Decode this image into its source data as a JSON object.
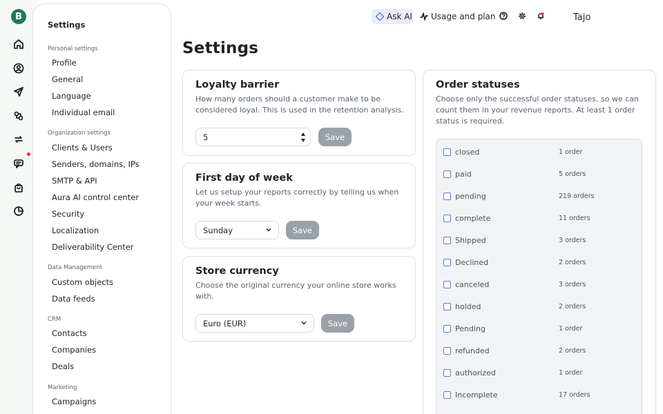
{
  "brand": {
    "logo_letter": "B"
  },
  "topbar": {
    "ask_ai": "Ask AI",
    "usage": "Usage and plan",
    "user_name": "Tajo"
  },
  "sidebar": {
    "title": "Settings",
    "sections": [
      {
        "label": "Personal settings",
        "items": [
          "Profile",
          "General",
          "Language",
          "Individual email"
        ]
      },
      {
        "label": "Organization settings",
        "items": [
          "Clients & Users",
          "Senders, domains, IPs",
          "SMTP & API",
          "Aura AI control center",
          "Security",
          "Localization",
          "Deliverability Center"
        ]
      },
      {
        "label": "Data Management",
        "items": [
          "Custom objects",
          "Data feeds"
        ]
      },
      {
        "label": "CRM",
        "items": [
          "Contacts",
          "Companies",
          "Deals"
        ]
      },
      {
        "label": "Marketing",
        "items": [
          "Campaigns"
        ]
      }
    ]
  },
  "page": {
    "title": "Settings"
  },
  "loyalty": {
    "title": "Loyalty barrier",
    "desc1": "How many orders should a customer make to be",
    "desc2": "considered loyal. This is used in the retention analysis.",
    "value": "5",
    "save": "Save"
  },
  "week": {
    "title": "First day of week",
    "desc1": "Let us setup your reports correctly by telling us when",
    "desc2": "your week starts.",
    "value": "Sunday",
    "save": "Save"
  },
  "currency": {
    "title": "Store currency",
    "desc1": "Choose the original currency your online store works",
    "desc2": "with.",
    "value": "Euro (EUR)",
    "save": "Save"
  },
  "statuses": {
    "title": "Order statuses",
    "desc1": "Choose only the successful order statuses, so we can",
    "desc2": "count them in your revenue reports. At least 1 order",
    "desc3": "status is required.",
    "items": [
      {
        "name": "closed",
        "count": "1 order"
      },
      {
        "name": "paid",
        "count": "5 orders"
      },
      {
        "name": "pending",
        "count": "219 orders"
      },
      {
        "name": "complete",
        "count": "11 orders"
      },
      {
        "name": "Shipped",
        "count": "3 orders"
      },
      {
        "name": "Declined",
        "count": "2 orders"
      },
      {
        "name": "canceled",
        "count": "3 orders"
      },
      {
        "name": "holded",
        "count": "2 orders"
      },
      {
        "name": "Pending",
        "count": "1 order"
      },
      {
        "name": "refunded",
        "count": "2 orders"
      },
      {
        "name": "authorized",
        "count": "1 order"
      },
      {
        "name": "Incomplete",
        "count": "17 orders"
      }
    ]
  },
  "colors": {
    "brand": "#1f7a5a",
    "save_disabled": "#9aa1a9",
    "notify_dot": "#e5342f",
    "checkbox": "#5b7bd5"
  }
}
